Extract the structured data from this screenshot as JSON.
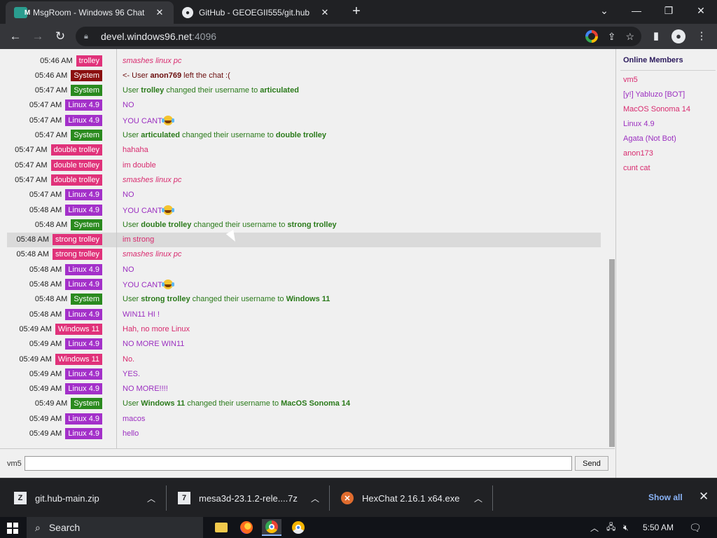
{
  "browser": {
    "tabs": [
      {
        "title": "MsgRoom - Windows 96 Chat",
        "close": "✕"
      },
      {
        "title": "GitHub - GEOEGII555/git.hub",
        "close": "✕"
      }
    ],
    "new_tab": "+",
    "url_host": "devel.windows96.net",
    "url_port": ":4096"
  },
  "colors": {
    "system": "#2a8a1e",
    "linux": "#a330c9",
    "user": "#e0327a",
    "anon": "#8b0f0f",
    "text_system": "#2a7a1a",
    "text_linux": "#9b2fc0",
    "text_user": "#d82a6e",
    "text_anon": "#6a0c0c"
  },
  "chat": {
    "messages": [
      {
        "time": "05:46 AM",
        "nick": "trolley",
        "kind": "user",
        "style": "action",
        "parts": [
          {
            "t": "smashes linux pc"
          }
        ]
      },
      {
        "time": "05:46 AM",
        "nick": "System",
        "kind": "anon",
        "parts": [
          {
            "t": "<- User "
          },
          {
            "t": "anon769",
            "b": true
          },
          {
            "t": " left the chat :("
          }
        ]
      },
      {
        "time": "05:47 AM",
        "nick": "System",
        "kind": "system",
        "parts": [
          {
            "t": "User "
          },
          {
            "t": "trolley",
            "b": true
          },
          {
            "t": " changed their username to "
          },
          {
            "t": "articulated",
            "b": true
          }
        ]
      },
      {
        "time": "05:47 AM",
        "nick": "Linux 4.9",
        "kind": "linux",
        "parts": [
          {
            "t": "NO"
          }
        ]
      },
      {
        "time": "05:47 AM",
        "nick": "Linux 4.9",
        "kind": "linux",
        "parts": [
          {
            "t": "YOU CANT"
          }
        ],
        "emoji": "laughing-emoji"
      },
      {
        "time": "05:47 AM",
        "nick": "System",
        "kind": "system",
        "parts": [
          {
            "t": "User "
          },
          {
            "t": "articulated",
            "b": true
          },
          {
            "t": " changed their username to "
          },
          {
            "t": "double trolley",
            "b": true
          }
        ]
      },
      {
        "time": "05:47 AM",
        "nick": "double trolley",
        "kind": "user",
        "parts": [
          {
            "t": "hahaha"
          }
        ]
      },
      {
        "time": "05:47 AM",
        "nick": "double trolley",
        "kind": "user",
        "parts": [
          {
            "t": "im double"
          }
        ]
      },
      {
        "time": "05:47 AM",
        "nick": "double trolley",
        "kind": "user",
        "style": "action",
        "parts": [
          {
            "t": "smashes linux pc"
          }
        ]
      },
      {
        "time": "05:47 AM",
        "nick": "Linux 4.9",
        "kind": "linux",
        "parts": [
          {
            "t": "NO"
          }
        ]
      },
      {
        "time": "05:48 AM",
        "nick": "Linux 4.9",
        "kind": "linux",
        "parts": [
          {
            "t": "YOU CANT"
          }
        ],
        "emoji": "laughing-emoji"
      },
      {
        "time": "05:48 AM",
        "nick": "System",
        "kind": "system",
        "parts": [
          {
            "t": "User "
          },
          {
            "t": "double trolley",
            "b": true
          },
          {
            "t": " changed their username to "
          },
          {
            "t": "strong trolley",
            "b": true
          }
        ]
      },
      {
        "time": "05:48 AM",
        "nick": "strong trolley",
        "kind": "user",
        "highlight": true,
        "parts": [
          {
            "t": "im strong"
          }
        ]
      },
      {
        "time": "05:48 AM",
        "nick": "strong trolley",
        "kind": "user",
        "style": "action",
        "parts": [
          {
            "t": "smashes linux pc"
          }
        ]
      },
      {
        "time": "05:48 AM",
        "nick": "Linux 4.9",
        "kind": "linux",
        "parts": [
          {
            "t": "NO"
          }
        ]
      },
      {
        "time": "05:48 AM",
        "nick": "Linux 4.9",
        "kind": "linux",
        "parts": [
          {
            "t": "YOU CANT"
          }
        ],
        "emoji": "laughing-emoji"
      },
      {
        "time": "05:48 AM",
        "nick": "System",
        "kind": "system",
        "parts": [
          {
            "t": "User "
          },
          {
            "t": "strong trolley",
            "b": true
          },
          {
            "t": " changed their username to "
          },
          {
            "t": "Windows 11",
            "b": true
          }
        ]
      },
      {
        "time": "05:48 AM",
        "nick": "Linux 4.9",
        "kind": "linux",
        "parts": [
          {
            "t": "WIN11 HI !"
          }
        ]
      },
      {
        "time": "05:49 AM",
        "nick": "Windows 11",
        "kind": "user",
        "parts": [
          {
            "t": "Hah, no more Linux"
          }
        ]
      },
      {
        "time": "05:49 AM",
        "nick": "Linux 4.9",
        "kind": "linux",
        "parts": [
          {
            "t": "NO MORE WIN11"
          }
        ]
      },
      {
        "time": "05:49 AM",
        "nick": "Windows 11",
        "kind": "user",
        "parts": [
          {
            "t": "No."
          }
        ]
      },
      {
        "time": "05:49 AM",
        "nick": "Linux 4.9",
        "kind": "linux",
        "parts": [
          {
            "t": "YES."
          }
        ]
      },
      {
        "time": "05:49 AM",
        "nick": "Linux 4.9",
        "kind": "linux",
        "parts": [
          {
            "t": "NO MORE!!!!"
          }
        ]
      },
      {
        "time": "05:49 AM",
        "nick": "System",
        "kind": "system",
        "parts": [
          {
            "t": "User "
          },
          {
            "t": "Windows 11",
            "b": true
          },
          {
            "t": " changed their username to "
          },
          {
            "t": "MacOS Sonoma 14",
            "b": true
          }
        ]
      },
      {
        "time": "05:49 AM",
        "nick": "Linux 4.9",
        "kind": "linux",
        "parts": [
          {
            "t": "macos"
          }
        ]
      },
      {
        "time": "05:49 AM",
        "nick": "Linux 4.9",
        "kind": "linux",
        "parts": [
          {
            "t": "hello"
          }
        ]
      }
    ],
    "input_user": "vm5",
    "input_value": "",
    "send_label": "Send"
  },
  "members": {
    "title": "Online Members",
    "list": [
      {
        "name": "vm5",
        "kind": "user"
      },
      {
        "name": "[y!] Yabluzo [BOT]",
        "kind": "linux"
      },
      {
        "name": "MacOS Sonoma 14",
        "kind": "user"
      },
      {
        "name": "Linux 4.9",
        "kind": "linux"
      },
      {
        "name": "Agata (Not Bot)",
        "kind": "linux"
      },
      {
        "name": "anon173",
        "kind": "user"
      },
      {
        "name": "cunt cat",
        "kind": "user"
      }
    ]
  },
  "downloads": {
    "items": [
      {
        "name": "git.hub-main.zip",
        "icon": "zip-file-icon"
      },
      {
        "name": "mesa3d-23.1.2-rele....7z",
        "icon": "7z-file-icon"
      },
      {
        "name": "HexChat 2.16.1 x64.exe",
        "icon": "exe-file-icon"
      }
    ],
    "show_all": "Show all",
    "close": "✕"
  },
  "taskbar": {
    "search_label": "Search",
    "clock": "5:50 AM"
  }
}
